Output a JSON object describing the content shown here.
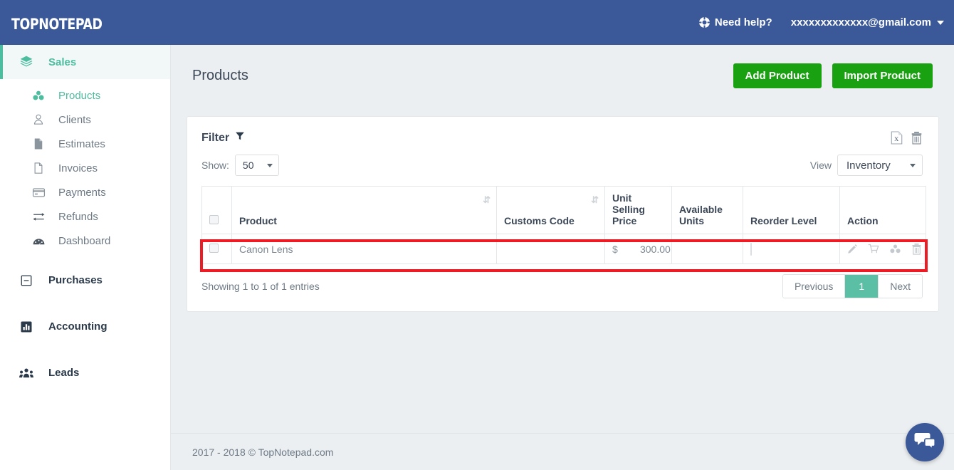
{
  "topbar": {
    "logo": "TopNotepad",
    "help_label": "Need help?",
    "help_icon": "lifebuoy-icon",
    "user_email": "xxxxxxxxxxxxx@gmail.com",
    "caret_icon": "caret-down-icon",
    "background_color": "#3b5898"
  },
  "sidebar": {
    "groups": [
      {
        "label": "Sales",
        "icon": "layers-icon",
        "active": true,
        "items": [
          {
            "label": "Products",
            "icon": "cubes-icon",
            "active": true
          },
          {
            "label": "Clients",
            "icon": "user-icon",
            "active": false
          },
          {
            "label": "Estimates",
            "icon": "file-filled-icon",
            "active": false
          },
          {
            "label": "Invoices",
            "icon": "file-outline-icon",
            "active": false
          },
          {
            "label": "Payments",
            "icon": "credit-card-icon",
            "active": false
          },
          {
            "label": "Refunds",
            "icon": "exchange-arrows-icon",
            "active": false
          },
          {
            "label": "Dashboard",
            "icon": "tachometer-icon",
            "active": false
          }
        ]
      },
      {
        "label": "Purchases",
        "icon": "minus-square-icon",
        "active": false,
        "items": []
      },
      {
        "label": "Accounting",
        "icon": "bar-chart-icon",
        "active": false,
        "items": []
      },
      {
        "label": "Leads",
        "icon": "users-group-icon",
        "active": false,
        "items": []
      }
    ],
    "active_color": "#4dbd9f"
  },
  "page": {
    "title": "Products",
    "add_button": "Add Product",
    "import_button": "Import Product",
    "button_color": "#1aa111"
  },
  "panel": {
    "filter_label": "Filter",
    "filter_icon": "funnel-icon",
    "export_excel_icon": "file-excel-icon",
    "delete_icon": "trash-icon",
    "show_label": "Show:",
    "show_value": "50",
    "view_label": "View",
    "view_value": "Inventory"
  },
  "table": {
    "columns": [
      {
        "label": "",
        "sortable": false
      },
      {
        "label": "Product",
        "sortable": true
      },
      {
        "label": "Customs Code",
        "sortable": true
      },
      {
        "label": "Unit Selling Price",
        "sortable": false
      },
      {
        "label": "Available Units",
        "sortable": false
      },
      {
        "label": "Reorder Level",
        "sortable": false
      },
      {
        "label": "Action",
        "sortable": false
      }
    ],
    "rows": [
      {
        "product": "Canon Lens",
        "customs_code": "",
        "currency_symbol": "$",
        "unit_selling_price": "300.00",
        "available_units": "",
        "reorder_level": "",
        "highlighted": true,
        "actions": [
          "pencil-icon",
          "cart-icon",
          "cubes-icon",
          "trash-icon"
        ]
      }
    ]
  },
  "pagination": {
    "entries_text": "Showing 1 to 1 of 1 entries",
    "previous_label": "Previous",
    "current_page": "1",
    "next_label": "Next",
    "active_color": "#5bbfa5"
  },
  "footer": {
    "copyright": "2017 - 2018 © TopNotepad.com"
  },
  "chat": {
    "icon": "chat-bubbles-icon",
    "color": "#3b5898"
  },
  "highlight": {
    "color": "#ee1b24"
  }
}
